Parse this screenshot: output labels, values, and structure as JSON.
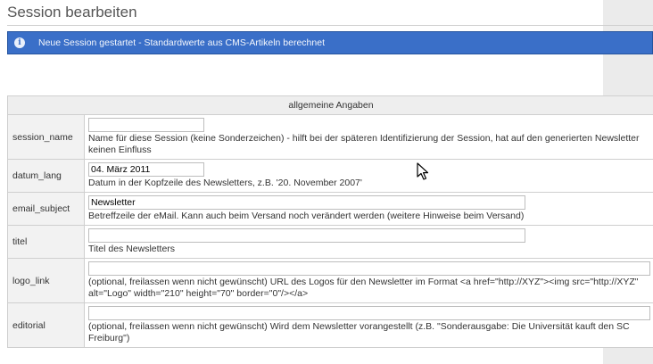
{
  "page": {
    "title": "Session bearbeiten"
  },
  "notice": {
    "icon": "info-icon",
    "text": "Neue Session gestartet - Standardwerte aus CMS-Artikeln berechnet"
  },
  "form": {
    "section_title": "allgemeine Angaben",
    "rows": [
      {
        "label": "session_name",
        "value": "",
        "hint": "Name für diese Session (keine Sonderzeichen) - hilft bei der späteren Identifizierung der Session, hat auf den generierten Newsletter keinen Einfluss"
      },
      {
        "label": "datum_lang",
        "value": "04. März 2011",
        "hint": "Datum in der Kopfzeile des Newsletters, z.B. '20. November 2007'"
      },
      {
        "label": "email_subject",
        "value": "Newsletter",
        "hint": "Betreffzeile der eMail. Kann auch beim Versand noch verändert werden (weitere Hinweise beim Versand)"
      },
      {
        "label": "titel",
        "value": "",
        "hint": "Titel des Newsletters"
      },
      {
        "label": "logo_link",
        "value": "",
        "hint": "(optional, freilassen wenn nicht gewünscht) URL des Logos für den Newsletter im Format <a href=\"http://XYZ\"><img src=\"http://XYZ\" alt=\"Logo\" width=\"210\" height=\"70\" border=\"0\"/></a>"
      },
      {
        "label": "editorial",
        "value": "",
        "hint": "(optional, freilassen wenn nicht gewünscht) Wird dem Newsletter vorangestellt (z.B. \"Sonderausgabe: Die Universität kauft den SC Freiburg\")"
      }
    ]
  },
  "colors": {
    "notice_bg": "#3a6fc8",
    "label_bg": "#f2f2f2",
    "side_panel": "#ebebeb"
  }
}
